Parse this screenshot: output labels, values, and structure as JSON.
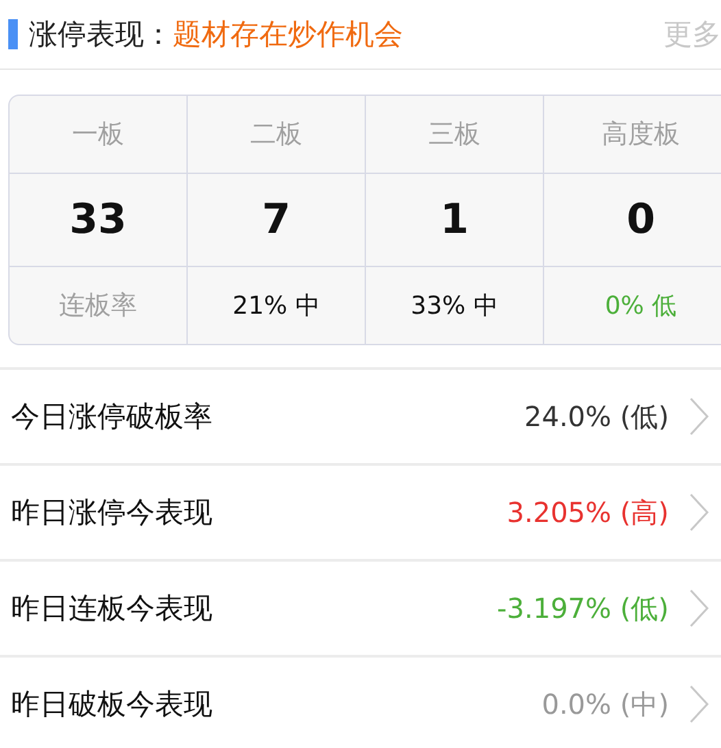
{
  "header": {
    "title": "涨停表现：",
    "subtitle": "题材存在炒作机会",
    "more": "更多"
  },
  "board_table": {
    "columns": [
      {
        "label": "一板",
        "count": "33"
      },
      {
        "label": "二板",
        "count": "7"
      },
      {
        "label": "三板",
        "count": "1"
      },
      {
        "label": "高度板",
        "count": "0"
      }
    ],
    "rate_label": "连板率",
    "rates": [
      {
        "text": "21% 中",
        "color": "#111111"
      },
      {
        "text": "33% 中",
        "color": "#111111"
      },
      {
        "text": "0% 低",
        "color": "#4caf3a"
      }
    ]
  },
  "metrics": [
    {
      "label": "今日涨停破板率",
      "value": "24.0% (低)",
      "color": "#333333"
    },
    {
      "label": "昨日涨停今表现",
      "value": "3.205% (高)",
      "color": "#e8322f"
    },
    {
      "label": "昨日连板今表现",
      "value": "-3.197% (低)",
      "color": "#4caf3a"
    },
    {
      "label": "昨日破板今表现",
      "value": "0.0% (中)",
      "color": "#999999"
    }
  ]
}
